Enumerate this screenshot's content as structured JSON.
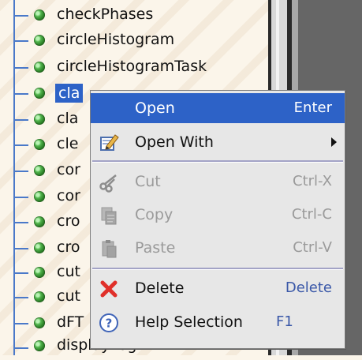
{
  "tree": {
    "items": [
      {
        "label": "checkPhases"
      },
      {
        "label": "circleHistogram"
      },
      {
        "label": "circleHistogramTask"
      },
      {
        "label": "cla"
      },
      {
        "label": "cla"
      },
      {
        "label": "cle"
      },
      {
        "label": "cor"
      },
      {
        "label": "cor"
      },
      {
        "label": "cro"
      },
      {
        "label": "cro"
      },
      {
        "label": "cut"
      },
      {
        "label": "cut"
      },
      {
        "label": "dFT"
      },
      {
        "label": "displayLog"
      }
    ]
  },
  "context_menu": {
    "open": {
      "label": "Open",
      "shortcut": "Enter"
    },
    "open_with": {
      "label": "Open With"
    },
    "cut": {
      "label": "Cut",
      "shortcut": "Ctrl-X"
    },
    "copy": {
      "label": "Copy",
      "shortcut": "Ctrl-C"
    },
    "paste": {
      "label": "Paste",
      "shortcut": "Ctrl-V"
    },
    "delete": {
      "label": "Delete",
      "shortcut": "Delete"
    },
    "help_selection": {
      "label": "Help Selection",
      "shortcut": "F1"
    }
  },
  "icons": {
    "open_with": "pencil-edit-icon",
    "cut": "scissors-icon",
    "copy": "copy-icon",
    "paste": "paste-icon",
    "delete": "red-x-icon",
    "help_selection": "help-icon"
  },
  "colors": {
    "selection": "#2d62c7",
    "tree_line": "#4a79c9",
    "menu_bg": "#e7e7e7",
    "disabled_text": "#9a9a9a"
  }
}
